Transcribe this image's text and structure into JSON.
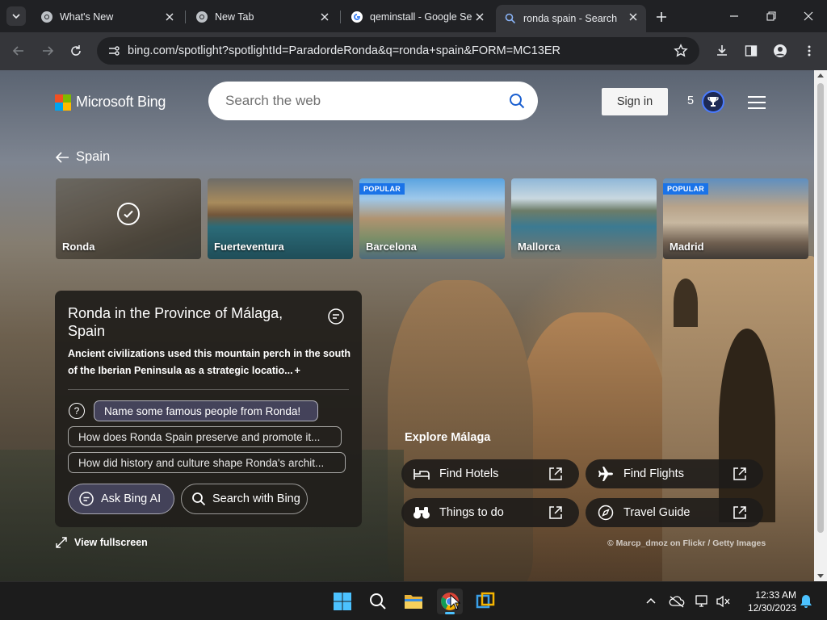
{
  "browser": {
    "tabs": [
      {
        "title": "What's New",
        "favicon": "chrome-icon",
        "active": false
      },
      {
        "title": "New Tab",
        "favicon": "chrome-icon",
        "active": false
      },
      {
        "title": "qeminstall - Google Se",
        "favicon": "google-icon",
        "active": false
      },
      {
        "title": "ronda spain - Search",
        "favicon": "bing-search-icon",
        "active": true
      }
    ],
    "url_host": "bing.com",
    "url_path": "/spotlight?spotlightId=ParadordeRonda&q=ronda+spain&FORM=MC13ER"
  },
  "header": {
    "brand": "Microsoft Bing",
    "search_placeholder": "Search the web",
    "sign_in": "Sign in",
    "rewards_count": "5"
  },
  "nav": {
    "back_label": "Spain"
  },
  "destinations": [
    {
      "name": "Ronda",
      "popular": false,
      "selected": true
    },
    {
      "name": "Fuerteventura",
      "popular": false,
      "selected": false
    },
    {
      "name": "Barcelona",
      "popular": true,
      "selected": false
    },
    {
      "name": "Mallorca",
      "popular": false,
      "selected": false
    },
    {
      "name": "Madrid",
      "popular": true,
      "selected": false
    }
  ],
  "popular_label": "POPULAR",
  "info": {
    "title": "Ronda in the Province of Málaga, Spain",
    "description": "Ancient civilizations used this mountain perch in the south of the Iberian Peninsula as a strategic locatio...",
    "more_symbol": "+",
    "questions": [
      "Name some famous people from Ronda!",
      "How does Ronda Spain preserve and promote it...",
      "How did history and culture shape Ronda's archit..."
    ],
    "ask_bing": "Ask Bing AI",
    "search_with_bing": "Search with Bing",
    "help_symbol": "?"
  },
  "view_fullscreen": "View fullscreen",
  "explore": {
    "title": "Explore Málaga",
    "buttons": [
      {
        "label": "Find Hotels",
        "icon": "bed-icon"
      },
      {
        "label": "Find Flights",
        "icon": "airplane-icon"
      },
      {
        "label": "Things to do",
        "icon": "binoculars-icon"
      },
      {
        "label": "Travel Guide",
        "icon": "compass-icon"
      }
    ]
  },
  "credit": "© Marcp_dmoz on Flickr / Getty Images",
  "taskbar": {
    "time": "12:33 AM",
    "date": "12/30/2023"
  },
  "colors": {
    "accent": "#4a7bff",
    "popular_badge": "#1a73e8",
    "chip_primary": "#5f5f8c"
  }
}
